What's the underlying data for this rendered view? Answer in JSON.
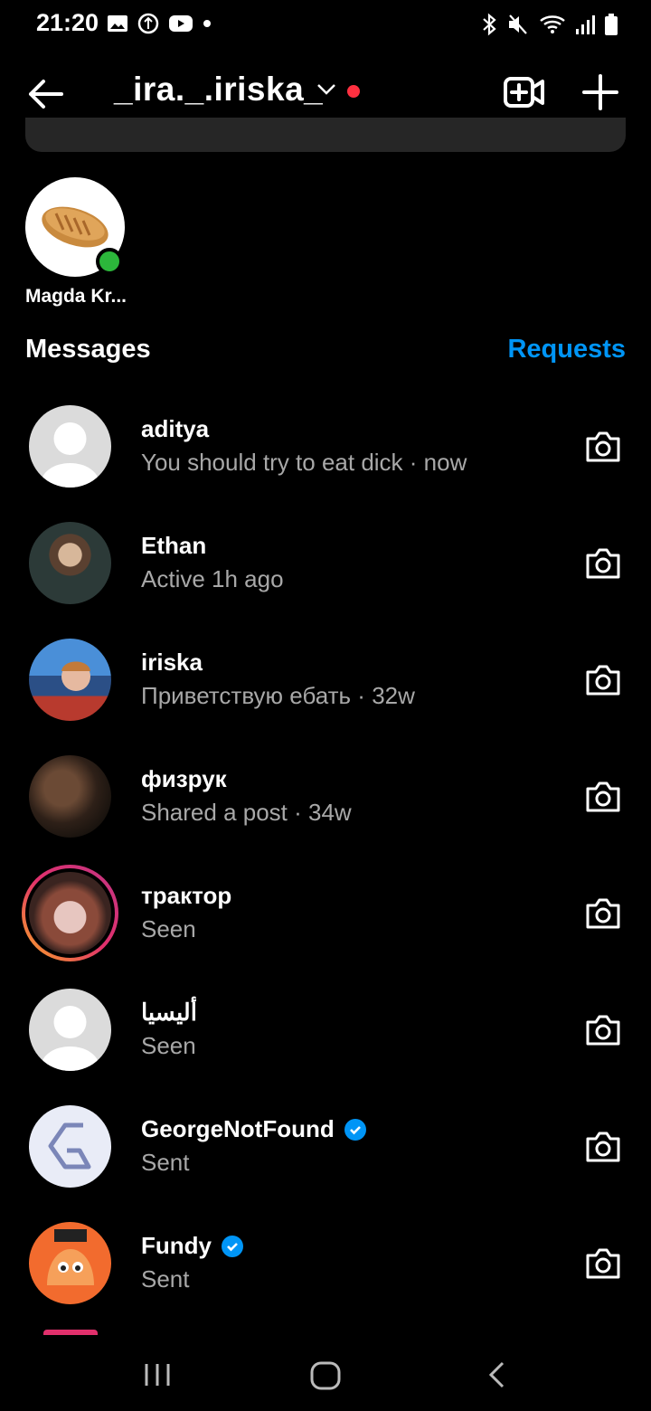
{
  "status_bar": {
    "time": "21:20"
  },
  "header": {
    "username": "_ira._.iriska_"
  },
  "notes": {
    "items": [
      {
        "name": "Magda Kr..."
      }
    ]
  },
  "section": {
    "title": "Messages",
    "requests_label": "Requests"
  },
  "colors": {
    "accent": "#0095f6",
    "online": "#2cb73b",
    "unread_dot": "#ff3040",
    "secondary_text": "#a8a8a8"
  },
  "threads": [
    {
      "name": "aditya",
      "subtitle": "You should try to eat dick · now",
      "avatar": "default-avatar-icon"
    },
    {
      "name": "Ethan",
      "subtitle": "Active 1h ago",
      "avatar": "photo"
    },
    {
      "name": "iriska",
      "subtitle": "Приветствую ебать · 32w",
      "avatar": "photo"
    },
    {
      "name": "физрук",
      "subtitle": "Shared a post · 34w",
      "avatar": "photo"
    },
    {
      "name": "трактор",
      "subtitle": "Seen",
      "avatar": "photo-story-ring"
    },
    {
      "name": "أليسيا",
      "subtitle": "Seen",
      "avatar": "default-avatar-icon"
    },
    {
      "name": "GeorgeNotFound",
      "subtitle": "Sent",
      "avatar": "logo",
      "verified": true
    },
    {
      "name": "Fundy",
      "subtitle": "Sent",
      "avatar": "cartoon-fox",
      "verified": true
    }
  ]
}
